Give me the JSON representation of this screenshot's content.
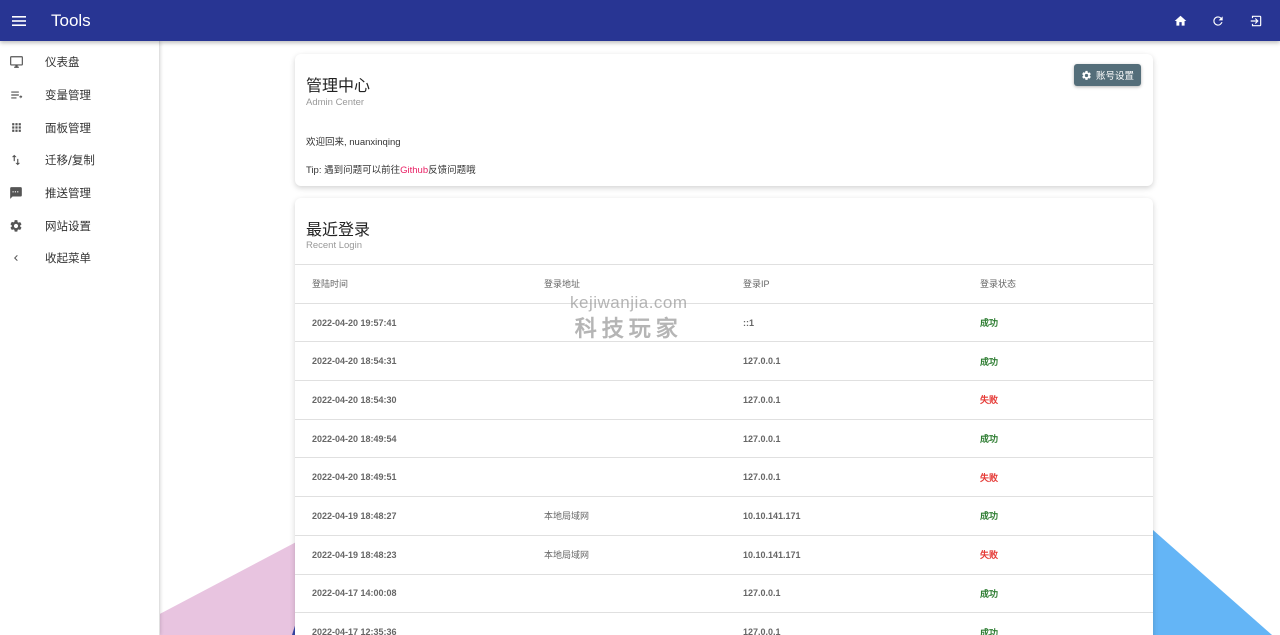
{
  "app": {
    "title": "Tools"
  },
  "colors": {
    "appbar": "#283593",
    "success": "#2e7d32",
    "failure": "#e53935",
    "link": "#e91e63",
    "button": "#546e7a"
  },
  "header_actions": [
    {
      "icon": "home-icon"
    },
    {
      "icon": "refresh-icon"
    },
    {
      "icon": "logout-icon"
    }
  ],
  "sidebar": {
    "items": [
      {
        "label": "仪表盘",
        "icon": "monitor-icon"
      },
      {
        "label": "变量管理",
        "icon": "list-icon"
      },
      {
        "label": "面板管理",
        "icon": "grid-icon"
      },
      {
        "label": "迁移/复制",
        "icon": "swap-vertical-icon"
      },
      {
        "label": "推送管理",
        "icon": "message-icon"
      },
      {
        "label": "网站设置",
        "icon": "gear-icon"
      },
      {
        "label": "收起菜单",
        "icon": "chevron-left-icon"
      }
    ]
  },
  "admin": {
    "title": "管理中心",
    "subtitle": "Admin Center",
    "settings_button": "账号设置",
    "welcome": "欢迎回来, nuanxinqing",
    "tip_prefix": "Tip: 遇到问题可以前往",
    "tip_link": "Github",
    "tip_suffix": "反馈问题哦"
  },
  "login": {
    "title": "最近登录",
    "subtitle": "Recent Login",
    "columns": [
      "登陆时间",
      "登录地址",
      "登录IP",
      "登录状态"
    ],
    "rows": [
      {
        "time": "2022-04-20 19:57:41",
        "location": "",
        "ip": "::1",
        "status": "成功",
        "ok": true
      },
      {
        "time": "2022-04-20 18:54:31",
        "location": "",
        "ip": "127.0.0.1",
        "status": "成功",
        "ok": true
      },
      {
        "time": "2022-04-20 18:54:30",
        "location": "",
        "ip": "127.0.0.1",
        "status": "失败",
        "ok": false
      },
      {
        "time": "2022-04-20 18:49:54",
        "location": "",
        "ip": "127.0.0.1",
        "status": "成功",
        "ok": true
      },
      {
        "time": "2022-04-20 18:49:51",
        "location": "",
        "ip": "127.0.0.1",
        "status": "失败",
        "ok": false
      },
      {
        "time": "2022-04-19 18:48:27",
        "location": "本地局域网",
        "ip": "10.10.141.171",
        "status": "成功",
        "ok": true
      },
      {
        "time": "2022-04-19 18:48:23",
        "location": "本地局域网",
        "ip": "10.10.141.171",
        "status": "失败",
        "ok": false
      },
      {
        "time": "2022-04-17 14:00:08",
        "location": "",
        "ip": "127.0.0.1",
        "status": "成功",
        "ok": true
      },
      {
        "time": "2022-04-17 12:35:36",
        "location": "",
        "ip": "127.0.0.1",
        "status": "成功",
        "ok": true
      }
    ]
  },
  "watermark": {
    "domain": "kejiwanjia.com",
    "name": "科技玩家"
  }
}
